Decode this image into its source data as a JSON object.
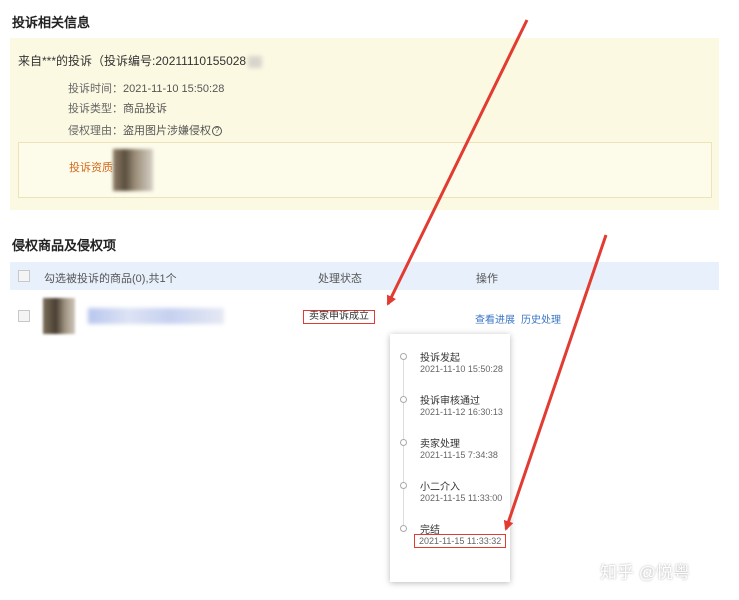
{
  "section1": {
    "title": "投诉相关信息"
  },
  "complaint": {
    "header": "来自***的投诉（投诉编号:20211110155028",
    "time_label": "投诉时间：",
    "time_value": "2021-11-10 15:50:28",
    "type_label": "投诉类型：",
    "type_value": "商品投诉",
    "reason_label": "侵权理由：",
    "reason_value": "盗用图片涉嫌侵权",
    "help_glyph": "?",
    "qualification_label": "投诉资质："
  },
  "section2": {
    "title": "侵权商品及侵权项"
  },
  "table": {
    "header_select": "勾选被投诉的商品(0),共1个",
    "header_status": "处理状态",
    "header_action": "操作",
    "row_status": "卖家申诉成立",
    "row_actions": [
      "查看进展",
      "历史处理"
    ]
  },
  "timeline": [
    {
      "label": "投诉发起",
      "time": "2021-11-10 15:50:28"
    },
    {
      "label": "投诉审核通过",
      "time": "2021-11-12 16:30:13"
    },
    {
      "label": "卖家处理",
      "time": "2021-11-15 7:34:38"
    },
    {
      "label": "小二介入",
      "time": "2021-11-15 11:33:00"
    },
    {
      "label": "完结",
      "time": "2021-11-15 11:33:32"
    }
  ],
  "watermark": "知乎 @悦粤",
  "colors": {
    "highlight_red": "#e23b32",
    "link_blue": "#3a75c4",
    "info_bg": "#fcf9e3",
    "header_bg": "#e8f1fb"
  }
}
